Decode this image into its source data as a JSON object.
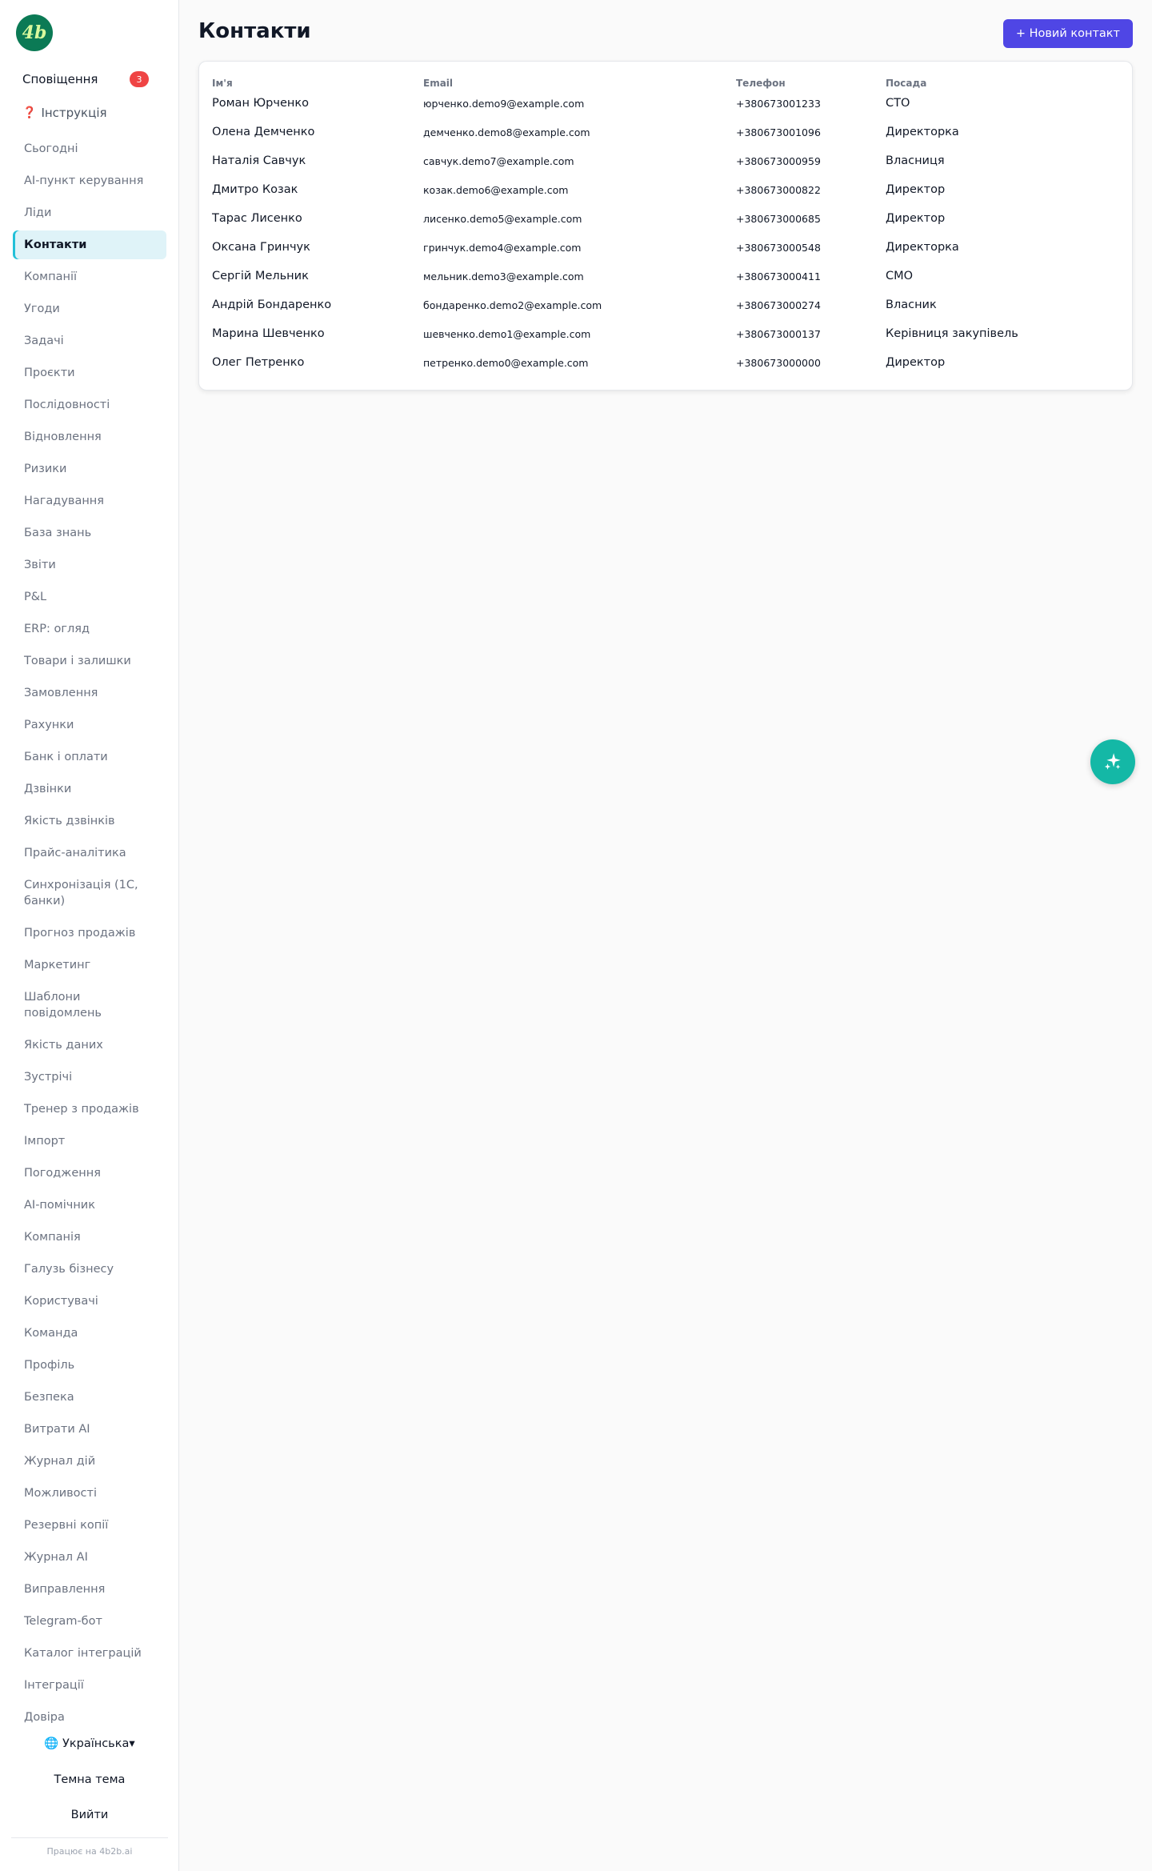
{
  "brand": {
    "logo_text": "4b"
  },
  "sidebar": {
    "notifications": {
      "label": "Сповіщення",
      "count": "3"
    },
    "guide": {
      "icon": "question-icon",
      "label": "Інструкція"
    },
    "items": [
      {
        "label": "Сьогодні"
      },
      {
        "label": "AI-пункт керування"
      },
      {
        "label": "Ліди"
      },
      {
        "label": "Контакти",
        "active": true
      },
      {
        "label": "Компанії"
      },
      {
        "label": "Угоди"
      },
      {
        "label": "Задачі"
      },
      {
        "label": "Проєкти"
      },
      {
        "label": "Послідовності"
      },
      {
        "label": "Відновлення"
      },
      {
        "label": "Ризики"
      },
      {
        "label": "Нагадування"
      },
      {
        "label": "База знань"
      },
      {
        "label": "Звіти"
      },
      {
        "label": "P&L"
      },
      {
        "label": "ERP: огляд"
      },
      {
        "label": "Товари і залишки"
      },
      {
        "label": "Замовлення"
      },
      {
        "label": "Рахунки"
      },
      {
        "label": "Банк і оплати"
      },
      {
        "label": "Дзвінки"
      },
      {
        "label": "Якість дзвінків"
      },
      {
        "label": "Прайс-аналітика"
      },
      {
        "label": "Синхронізація (1С, банки)"
      },
      {
        "label": "Прогноз продажів"
      },
      {
        "label": "Маркетинг"
      },
      {
        "label": "Шаблони повідомлень"
      },
      {
        "label": "Якість даних"
      },
      {
        "label": "Зустрічі"
      },
      {
        "label": "Тренер з продажів"
      },
      {
        "label": "Імпорт"
      },
      {
        "label": "Погодження"
      },
      {
        "label": "AI-помічник"
      },
      {
        "label": "Компанія"
      },
      {
        "label": "Галузь бізнесу"
      },
      {
        "label": "Користувачі"
      },
      {
        "label": "Команда"
      },
      {
        "label": "Профіль"
      },
      {
        "label": "Безпека"
      },
      {
        "label": "Витрати AI"
      },
      {
        "label": "Журнал дій"
      },
      {
        "label": "Можливості"
      },
      {
        "label": "Резервні копії"
      },
      {
        "label": "Журнал AI"
      },
      {
        "label": "Виправлення"
      },
      {
        "label": "Telegram-бот"
      },
      {
        "label": "Каталог інтеграцій"
      },
      {
        "label": "Інтеграції"
      },
      {
        "label": "Довіра"
      }
    ],
    "language": {
      "icon": "globe-icon",
      "label": "Українська",
      "caret": "▾"
    },
    "theme_label": "Темна тема",
    "logout_label": "Вийти",
    "powered_by": "Працює на 4b2b.ai"
  },
  "page": {
    "title": "Контакти",
    "new_button": "+ Новий контакт"
  },
  "table": {
    "headers": [
      "Ім'я",
      "Email",
      "Телефон",
      "Посада"
    ],
    "rows": [
      [
        "Роман Юрченко",
        "юрченко.demo9@example.com",
        "+380673001233",
        "CTO"
      ],
      [
        "Олена Демченко",
        "демченко.demo8@example.com",
        "+380673001096",
        "Директорка"
      ],
      [
        "Наталія Савчук",
        "савчук.demo7@example.com",
        "+380673000959",
        "Власниця"
      ],
      [
        "Дмитро Козак",
        "козак.demo6@example.com",
        "+380673000822",
        "Директор"
      ],
      [
        "Тарас Лисенко",
        "лисенко.demo5@example.com",
        "+380673000685",
        "Директор"
      ],
      [
        "Оксана Гринчук",
        "гринчук.demo4@example.com",
        "+380673000548",
        "Директорка"
      ],
      [
        "Сергій Мельник",
        "мельник.demo3@example.com",
        "+380673000411",
        "CMO"
      ],
      [
        "Андрій Бондаренко",
        "бондаренко.demo2@example.com",
        "+380673000274",
        "Власник"
      ],
      [
        "Марина Шевченко",
        "шевченко.demo1@example.com",
        "+380673000137",
        "Керівниця закупівель"
      ],
      [
        "Олег Петренко",
        "петренко.demo0@example.com",
        "+380673000000",
        "Директор"
      ]
    ]
  },
  "fab": {
    "icon": "sparkles-icon"
  },
  "colors": {
    "accent": "#4f46e5",
    "brand_green": "#0b7a55",
    "active_bg": "#dff3f8",
    "fab": "#14b8a6",
    "badge": "#ef4444"
  }
}
